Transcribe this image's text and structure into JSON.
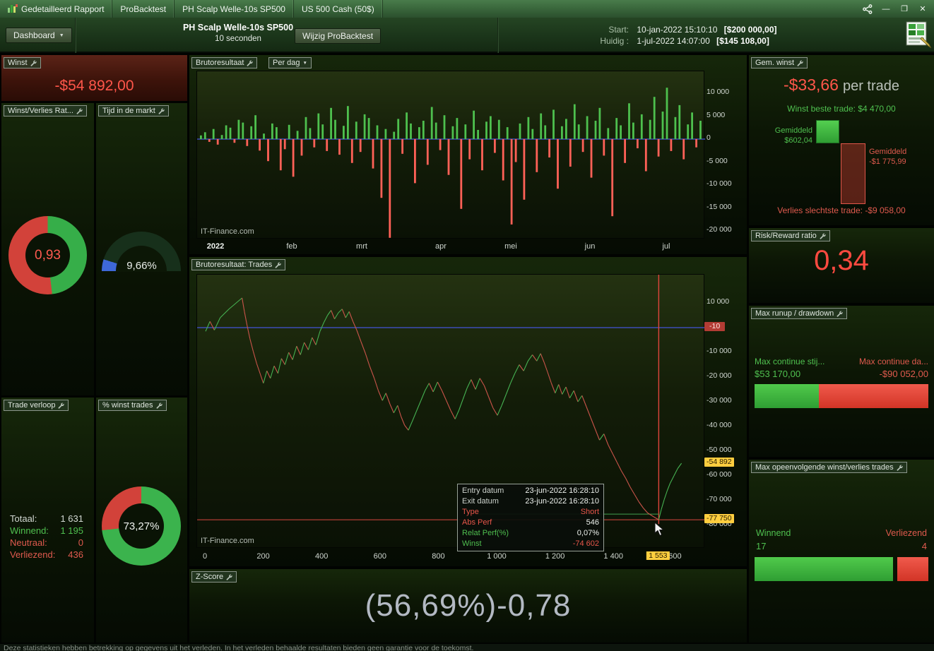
{
  "window": {
    "tabs": [
      "Gedetailleerd Rapport",
      "ProBacktest",
      "PH Scalp Welle-10s SP500",
      "US 500 Cash (50$)"
    ]
  },
  "icons": {
    "minimize": "—",
    "maximize": "❐",
    "close": "✕",
    "caret_down": "▼"
  },
  "toolbar": {
    "dashboard_label": "Dashboard",
    "strategy_name": "PH Scalp Welle-10s SP500",
    "timeframe": "10 seconden",
    "wijzig_label": "Wijzig ProBacktest",
    "start_label": "Start:",
    "start_datetime": "10-jan-2022 15:10:10",
    "start_amount": "[$200 000,00]",
    "huidig_label": "Huidig :",
    "huidig_datetime": "1-jul-2022 14:07:00",
    "huidig_amount": "[$145 108,00]"
  },
  "panels": {
    "winst": {
      "title": "Winst",
      "value": "-$54 892,00"
    },
    "wl_ratio": {
      "title": "Winst/Verlies Rat...",
      "value": "0,93",
      "green_fraction": 0.482
    },
    "tijd_markt": {
      "title": "Tijd in de markt",
      "value": "9,66%",
      "fraction": 0.0966
    },
    "trade_verloop": {
      "title": "Trade verloop",
      "rows": [
        {
          "label": "Totaal:",
          "value": "1 631"
        },
        {
          "label": "Winnend:",
          "value": "1 195"
        },
        {
          "label": "Neutraal:",
          "value": "0"
        },
        {
          "label": "Verliezend:",
          "value": "436"
        }
      ]
    },
    "pct_winst": {
      "title": "% winst trades",
      "value": "73,27%",
      "green_fraction": 0.7327
    },
    "bruto_dag": {
      "title": "Brutoresultaat",
      "dropdown_label": "Per dag",
      "watermark": "IT-Finance.com"
    },
    "bruto_trades": {
      "title": "Brutoresultaat: Trades",
      "watermark": "IT-Finance.com",
      "tooltip": {
        "rows": [
          {
            "label": "Entry datum",
            "value": "23-jun-2022 16:28:10"
          },
          {
            "label": "Exit datum",
            "value": "23-jun-2022 16:28:10"
          },
          {
            "label": "Type",
            "value": "Short"
          },
          {
            "label": "Abs Perf",
            "value": "546"
          },
          {
            "label": "Relat Perf(%)",
            "value": "0,07%"
          },
          {
            "label": "Winst",
            "value": "-74 602"
          }
        ]
      }
    },
    "zscore": {
      "title": "Z-Score",
      "value": "(56,69%)-0,78"
    },
    "gem_winst": {
      "title": "Gem. winst",
      "value": "-$33,66",
      "suffix": "per trade",
      "best": "Winst beste trade: $4 470,00",
      "avg_win_label": "Gemiddeld",
      "avg_win_value": "$602,04",
      "avg_loss_label": "Gemiddeld",
      "avg_loss_value": "-$1 775,99",
      "worst": "Verlies slechtste trade: -$9 058,00"
    },
    "risk_reward": {
      "title": "Risk/Reward ratio",
      "value": "0,34"
    },
    "max_runup": {
      "title": "Max runup / drawdown",
      "up_label": "Max continue stij...",
      "up_value": "$53 170,00",
      "up_fraction": 0.371,
      "down_label": "Max continue da...",
      "down_value": "-$90 052,00",
      "down_fraction": 0.629
    },
    "max_consec": {
      "title": "Max opeenvolgende winst/verlies trades",
      "win_label": "Winnend",
      "win_value": "17",
      "win_fraction": 0.795,
      "loss_label": "Verliezend",
      "loss_value": "4",
      "loss_fraction": 0.18
    }
  },
  "footer": "Deze statistieken hebben betrekking op gegevens uit het verleden. In het verleden behaalde resultaten bieden geen garantie voor de toekomst.",
  "chart_data": [
    {
      "type": "bar",
      "title": "Brutoresultaat Per dag",
      "x_axis_labels": [
        "2022",
        "feb",
        "mrt",
        "apr",
        "mei",
        "jun",
        "jul"
      ],
      "y_ticks": [
        "10 000",
        "5 000",
        "0",
        "-5 000",
        "-10 000",
        "-15 000",
        "-20 000"
      ],
      "y_tick_values": [
        10000,
        5000,
        0,
        -5000,
        -10000,
        -15000,
        -20000
      ],
      "ylim": [
        -22000,
        12000
      ],
      "values": [
        800,
        1500,
        -600,
        2200,
        -1200,
        900,
        3000,
        2500,
        -800,
        4200,
        3600,
        -1500,
        2800,
        5200,
        -2500,
        1200,
        -4800,
        3400,
        2600,
        -6800,
        -2200,
        3100,
        -8200,
        1800,
        -3600,
        4800,
        2400,
        -1800,
        5600,
        3200,
        -2600,
        6800,
        4200,
        -3400,
        2900,
        7200,
        -5200,
        3800,
        -2800,
        5400,
        4600,
        -6400,
        3000,
        -12800,
        2200,
        -21500,
        1600,
        4400,
        -3200,
        5800,
        3400,
        -9600,
        2600,
        4000,
        -5600,
        7000,
        3600,
        -2400,
        5200,
        -7800,
        2800,
        4600,
        -15200,
        3200,
        -4400,
        6200,
        2000,
        -6800,
        3800,
        5000,
        -3000,
        4200,
        -9000,
        2600,
        -18600,
        -5000,
        3400,
        -13200,
        4800,
        2200,
        -7200,
        5600,
        3000,
        -4000,
        6400,
        -10800,
        2800,
        4400,
        -6000,
        7600,
        3200,
        -2800,
        5000,
        -8400,
        4000,
        6800,
        -3600,
        2400,
        -16800,
        4600,
        3000,
        -5200,
        7800,
        3600,
        -2000,
        5400,
        -7000,
        4200,
        9200,
        -3800,
        6000,
        11200,
        -2600,
        4800,
        7400,
        -4400,
        3200,
        5800,
        -1800,
        4000
      ]
    },
    {
      "type": "line",
      "title": "Brutoresultaat: Trades",
      "x_ticks": [
        "0",
        "200",
        "400",
        "600",
        "800",
        "1 000",
        "1 200",
        "1 400",
        "1 600"
      ],
      "y_ticks": [
        "10 000",
        "-10 000",
        "-20 000",
        "-30 000",
        "-40 000",
        "-50 000",
        "-60 000",
        "-70 000",
        "-80 000"
      ],
      "y_tick_values": [
        10000,
        -10000,
        -20000,
        -30000,
        -40000,
        -50000,
        -60000,
        -70000,
        -80000
      ],
      "zero_label": "-10",
      "current_label": "-54 892",
      "current_value": -54892,
      "min_label": "-77 750",
      "min_value": -77750,
      "x_current_label": "1 553",
      "x_current_value": 1553,
      "points": [
        [
          0,
          -1500
        ],
        [
          15,
          2500
        ],
        [
          30,
          -1000
        ],
        [
          50,
          4000
        ],
        [
          80,
          7500
        ],
        [
          110,
          10500
        ],
        [
          125,
          12000
        ],
        [
          133,
          6500
        ],
        [
          142,
          1000
        ],
        [
          152,
          -4500
        ],
        [
          163,
          -9500
        ],
        [
          175,
          -14500
        ],
        [
          188,
          -19000
        ],
        [
          198,
          -22500
        ],
        [
          210,
          -17500
        ],
        [
          222,
          -20500
        ],
        [
          235,
          -15500
        ],
        [
          248,
          -18500
        ],
        [
          260,
          -12500
        ],
        [
          272,
          -15000
        ],
        [
          285,
          -10000
        ],
        [
          298,
          -13000
        ],
        [
          312,
          -7500
        ],
        [
          325,
          -11000
        ],
        [
          338,
          -6000
        ],
        [
          352,
          -9000
        ],
        [
          365,
          -4000
        ],
        [
          378,
          -7000
        ],
        [
          392,
          -1500
        ],
        [
          405,
          2000
        ],
        [
          418,
          5000
        ],
        [
          430,
          7000
        ],
        [
          442,
          3500
        ],
        [
          455,
          6000
        ],
        [
          468,
          7500
        ],
        [
          480,
          4000
        ],
        [
          492,
          6500
        ],
        [
          505,
          2500
        ],
        [
          518,
          -1000
        ],
        [
          532,
          -5500
        ],
        [
          548,
          -10500
        ],
        [
          562,
          -15500
        ],
        [
          578,
          -20500
        ],
        [
          592,
          -25500
        ],
        [
          606,
          -29500
        ],
        [
          618,
          -26500
        ],
        [
          632,
          -31000
        ],
        [
          645,
          -34500
        ],
        [
          658,
          -31500
        ],
        [
          670,
          -36000
        ],
        [
          682,
          -39500
        ],
        [
          695,
          -41500
        ],
        [
          708,
          -38000
        ],
        [
          722,
          -34000
        ],
        [
          738,
          -29500
        ],
        [
          752,
          -25500
        ],
        [
          766,
          -22500
        ],
        [
          780,
          -26000
        ],
        [
          795,
          -22000
        ],
        [
          810,
          -25500
        ],
        [
          825,
          -29500
        ],
        [
          840,
          -33500
        ],
        [
          855,
          -37000
        ],
        [
          868,
          -33500
        ],
        [
          882,
          -29000
        ],
        [
          896,
          -24500
        ],
        [
          910,
          -21000
        ],
        [
          925,
          -25000
        ],
        [
          940,
          -20500
        ],
        [
          955,
          -23500
        ],
        [
          970,
          -28000
        ],
        [
          985,
          -32500
        ],
        [
          1000,
          -35500
        ],
        [
          1015,
          -31500
        ],
        [
          1030,
          -27000
        ],
        [
          1045,
          -22500
        ],
        [
          1060,
          -18500
        ],
        [
          1075,
          -15000
        ],
        [
          1090,
          -17500
        ],
        [
          1105,
          -13500
        ],
        [
          1120,
          -11000
        ],
        [
          1135,
          -13500
        ],
        [
          1148,
          -10500
        ],
        [
          1160,
          -14000
        ],
        [
          1172,
          -18000
        ],
        [
          1185,
          -22500
        ],
        [
          1198,
          -26500
        ],
        [
          1210,
          -23000
        ],
        [
          1222,
          -27000
        ],
        [
          1235,
          -24000
        ],
        [
          1248,
          -28500
        ],
        [
          1262,
          -25500
        ],
        [
          1276,
          -30000
        ],
        [
          1290,
          -27500
        ],
        [
          1305,
          -32000
        ],
        [
          1320,
          -36500
        ],
        [
          1335,
          -41000
        ],
        [
          1350,
          -45500
        ],
        [
          1365,
          -43000
        ],
        [
          1380,
          -47500
        ],
        [
          1395,
          -51000
        ],
        [
          1410,
          -54500
        ],
        [
          1425,
          -58000
        ],
        [
          1440,
          -61000
        ],
        [
          1455,
          -64500
        ],
        [
          1470,
          -67500
        ],
        [
          1485,
          -70500
        ],
        [
          1500,
          -73000
        ],
        [
          1515,
          -75000
        ],
        [
          1535,
          -76500
        ],
        [
          1553,
          -77750
        ],
        [
          1562,
          -73500
        ],
        [
          1572,
          -69500
        ],
        [
          1582,
          -66000
        ],
        [
          1592,
          -63000
        ],
        [
          1605,
          -60000
        ],
        [
          1618,
          -57000
        ],
        [
          1631,
          -54892
        ]
      ]
    }
  ]
}
